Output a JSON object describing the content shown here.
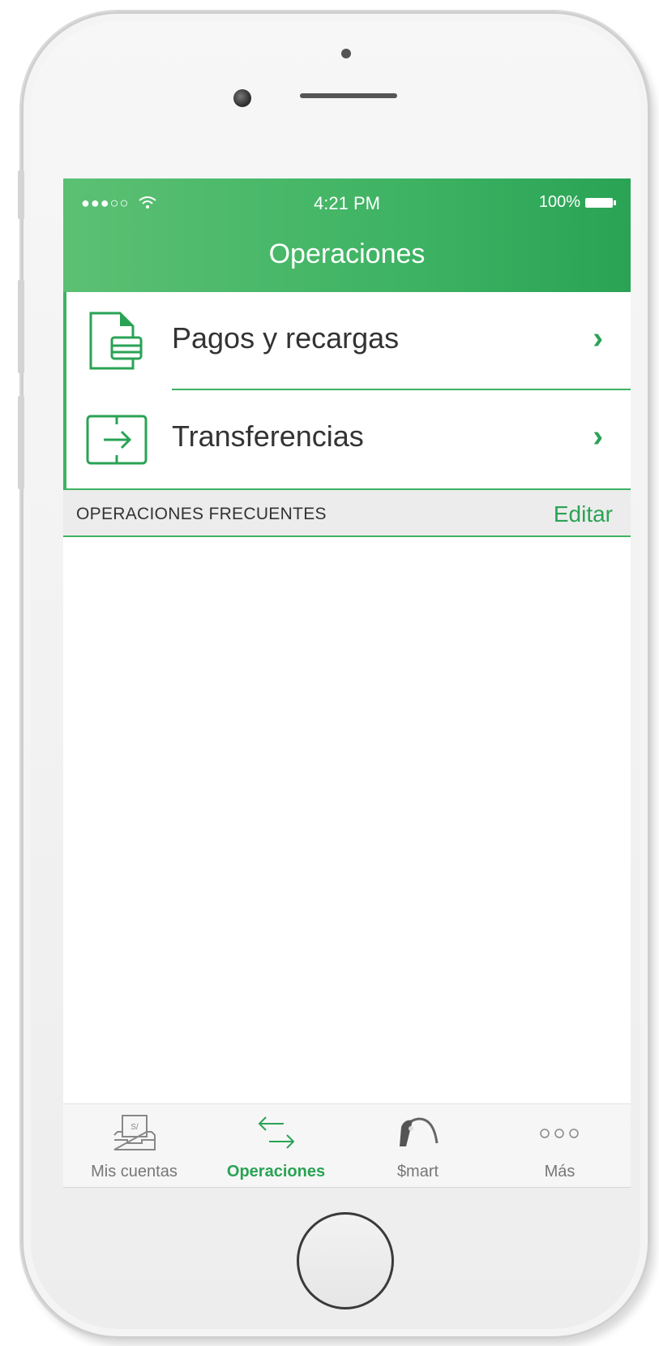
{
  "status_bar": {
    "signal": "●●●○○",
    "time": "4:21 PM",
    "battery": "100%"
  },
  "nav": {
    "title": "Operaciones"
  },
  "menu": {
    "items": [
      {
        "label": "Pagos y recargas",
        "icon": "document-card-icon"
      },
      {
        "label": "Transferencias",
        "icon": "transfer-arrow-icon"
      }
    ]
  },
  "frequent": {
    "title": "OPERACIONES FRECUENTES",
    "edit_label": "Editar"
  },
  "tabbar": {
    "tabs": [
      {
        "label": "Mis cuentas",
        "icon": "accounts-tray-icon",
        "active": false
      },
      {
        "label": "Operaciones",
        "icon": "swap-arrows-icon",
        "active": true
      },
      {
        "label": "$mart",
        "icon": "smart-key-icon",
        "active": false
      },
      {
        "label": "Más",
        "icon": "more-dots-icon",
        "active": false
      }
    ]
  },
  "colors": {
    "accent": "#3eb363",
    "header_start": "#5cc073",
    "header_end": "#2aa355",
    "section_bg": "#ececec"
  }
}
